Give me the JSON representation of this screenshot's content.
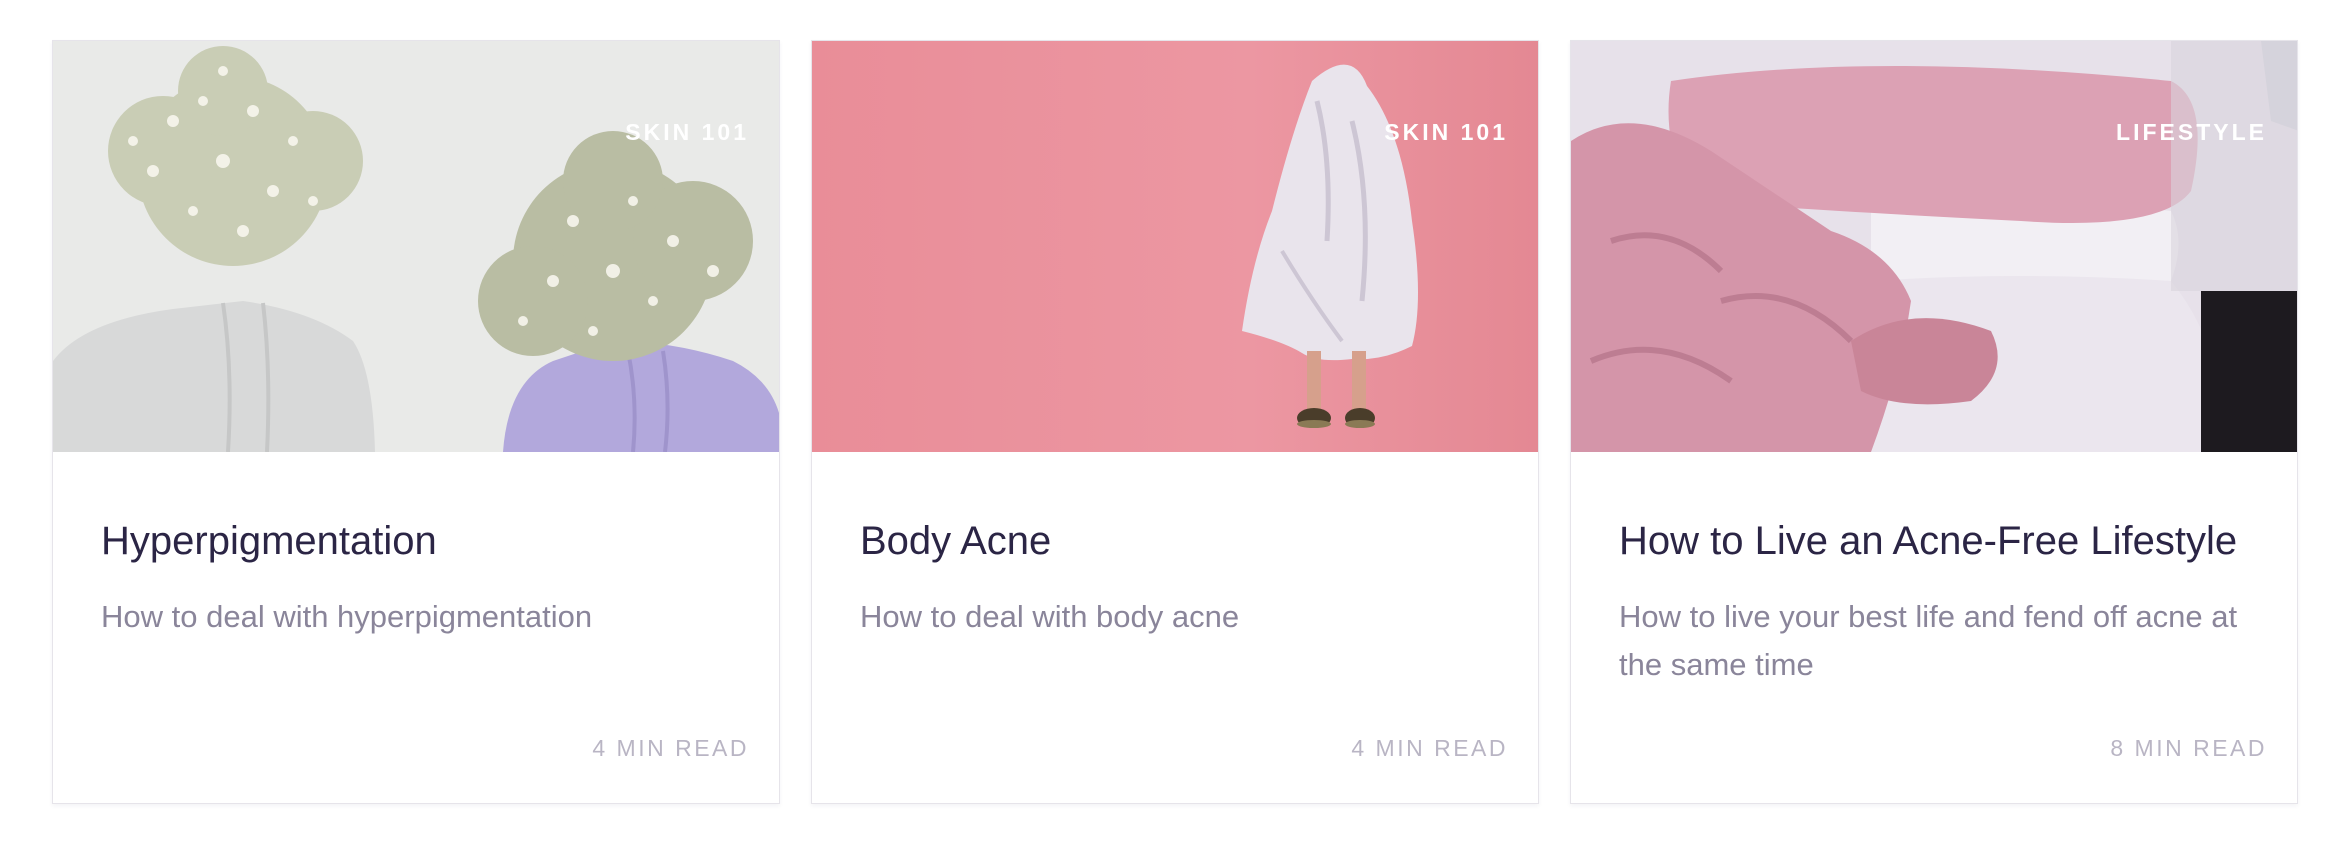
{
  "colors": {
    "title": "#2b2545",
    "description": "#8a859a",
    "read_time": "#b9b5c4",
    "card_border": "#e6e4ea"
  },
  "cards": [
    {
      "image": "hyperpigmentation-photo",
      "category": "SKIN 101",
      "title": "Hyperpigmentation",
      "description": "How to deal with hyperpigmentation",
      "read_time": "4 MIN READ"
    },
    {
      "image": "body-acne-photo",
      "category": "SKIN 101",
      "title": "Body Acne",
      "description": "How to deal with body acne",
      "read_time": "4 MIN READ"
    },
    {
      "image": "lifestyle-photo",
      "category": "LIFESTYLE",
      "title": "How to Live an Acne-Free Lifestyle",
      "description": "How to live your best life and fend off acne at the same time",
      "read_time": "8 MIN READ"
    }
  ]
}
